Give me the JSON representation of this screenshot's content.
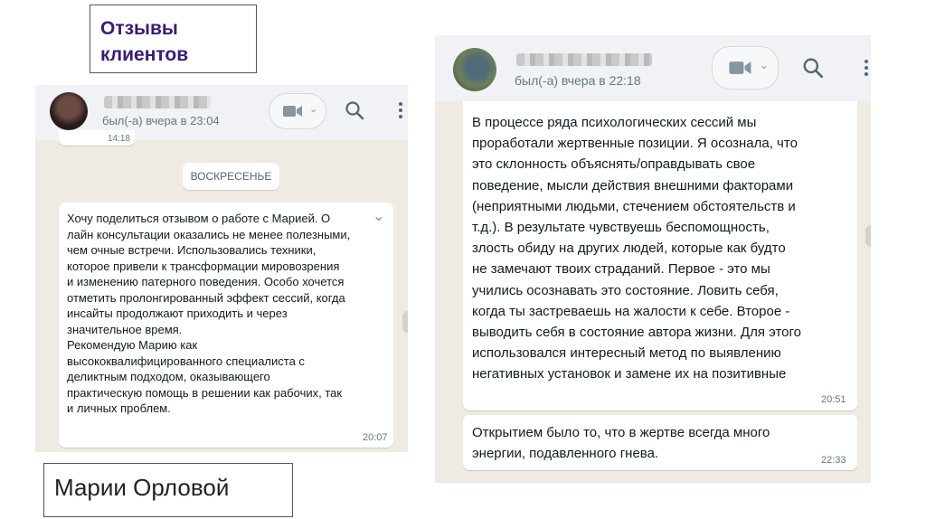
{
  "heading": "Отзывы\nклиентов",
  "caption": "Марии Орловой",
  "left_chat": {
    "last_seen": "был(-а) вчера в 23:04",
    "prev_time": "14:18",
    "day_label": "ВОСКРЕСЕНЬЕ",
    "message": "Хочу поделиться отзывом о работе с Марией. О\nлайн консультации оказались не менее полезными,\nчем очные встречи. Использовались техники,\nкоторое привели к трансформации мировозрения\nи изменению патерного поведения. Особо хочется\nотметить пролонгированный эффект сессий, когда\nинсайты продолжают приходить и через\nзначительное время.\nРекомендую Марию как\nвысококвалифицированного специалиста с\nделиктным подходом, оказывающего\nпрактическую помощь в решении как рабочих, так\nи личных проблем.",
    "message_time": "20:07"
  },
  "right_chat": {
    "last_seen": "был(-а) вчера в 22:18",
    "message1": "В процессе ряда психологических сессий мы\nпроработали жертвенные позиции. Я осознала, что\nэто склонность объяснять/оправдывать свое\nповедение, мысли действия внешними факторами\n(неприятными людьми, стечением обстоятельств и\nт.д.). В результате чувствуешь беспомощность,\nзлость обиду на других людей, которые как будто\nне замечают твоих страданий. Первое - это мы\nучились осознавать это состояние. Ловить себя,\nкогда ты застреваешь на жалости к себе. Второе -\nвыводить себя в состояние автора жизни. Для этого\nиспользовался интересный метод по выявлению\nнегативных установок и замене их на позитивные",
    "message1_time": "20:51",
    "message2": "Открытием было то, что в жертве всегда много\nэнергии, подавленного гнева.",
    "message2_time": "22:33"
  },
  "icons": [
    "video-camera-icon",
    "chevron-down-icon",
    "search-icon",
    "more-vertical-icon"
  ],
  "colors": {
    "heading": "#3b1a78",
    "chat_bg": "#efeae2",
    "header_bg": "#f0f2f5",
    "bubble": "#ffffff"
  }
}
